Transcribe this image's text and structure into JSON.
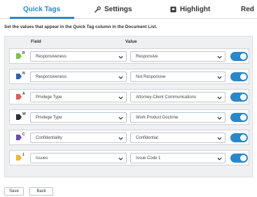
{
  "tabs": [
    {
      "label": "Quick Tags",
      "icon": "none",
      "active": true
    },
    {
      "label": "Settings",
      "icon": "wrench-icon",
      "active": false
    },
    {
      "label": "Highlight",
      "icon": "highlight-icon",
      "active": false
    },
    {
      "label": "Red",
      "icon": "none",
      "active": false
    }
  ],
  "instructions": "Set the values that appear in the Quick Tag column in the Document List.",
  "columns": {
    "field": "Field",
    "value": "Value"
  },
  "rows": [
    {
      "color": "#7cc242",
      "shortcut": "R",
      "field": "Responsiveness",
      "value": "Responsive",
      "enabled": true
    },
    {
      "color": "#2e63b8",
      "shortcut": "N",
      "field": "Responsiveness",
      "value": "Not Responsive",
      "enabled": true
    },
    {
      "color": "#e05a5a",
      "shortcut": "A",
      "field": "Privilege Type",
      "value": "Attorney-Client Communications",
      "enabled": true
    },
    {
      "color": "#2a2f36",
      "shortcut": "W",
      "field": "Privilege Type",
      "value": "Work Product Doctrine",
      "enabled": true
    },
    {
      "color": "#6a4fb3",
      "shortcut": "C",
      "field": "Confidentiality",
      "value": "Confidential",
      "enabled": true
    },
    {
      "color": "#f2b632",
      "shortcut": "1",
      "field": "Issues",
      "value": "Issue Code 1",
      "enabled": true
    }
  ],
  "buttons": {
    "save": "Save",
    "back": "Back"
  },
  "colors": {
    "accent": "#2b88c8",
    "panel": "#eef0f2"
  }
}
